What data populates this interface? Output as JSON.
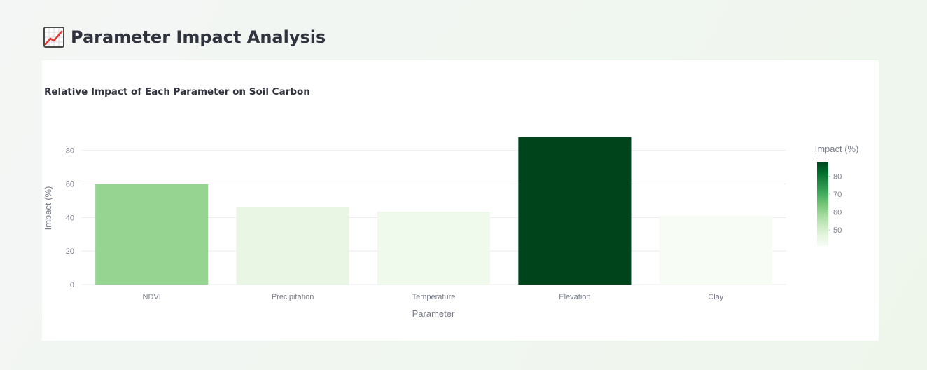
{
  "page": {
    "title": "Parameter Impact Analysis",
    "title_icon": "chart-increasing-icon"
  },
  "chart_data": {
    "type": "bar",
    "title": "Relative Impact of Each Parameter on Soil Carbon",
    "xlabel": "Parameter",
    "ylabel": "Impact (%)",
    "categories": [
      "NDVI",
      "Precipitation",
      "Temperature",
      "Elevation",
      "Clay"
    ],
    "values": [
      60,
      46,
      43.5,
      88,
      41
    ],
    "ylim": [
      0,
      92
    ],
    "yticks": [
      0,
      20,
      40,
      60,
      80
    ],
    "grid": true,
    "colorbar": {
      "title": "Impact (%)",
      "ticks": [
        50,
        60,
        70,
        80
      ],
      "range": [
        41,
        88
      ],
      "colorscale": "Greens",
      "placement": "right"
    }
  },
  "colors": {
    "scale_low": "#f7fcf5",
    "scale_high": "#00441b",
    "grid": "#e9ebef",
    "text": "#31333f",
    "muted_text": "#7a7d8c"
  }
}
